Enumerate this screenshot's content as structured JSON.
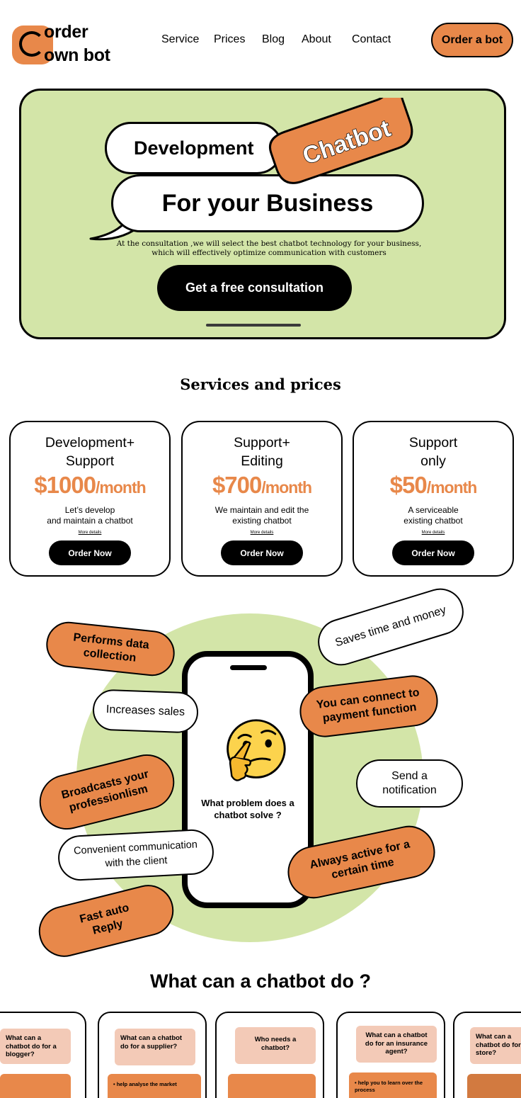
{
  "header": {
    "logo_line1": "order",
    "logo_line2": "own bot",
    "nav": [
      "Service",
      "Prices",
      "Blog",
      "About",
      "Contact"
    ],
    "cta": "Order a bot"
  },
  "hero": {
    "line1": "Development",
    "bubble": "Chatbot",
    "line2": "For your Business",
    "subtitle_1": "At the consultation ,we will select the best chatbot technology for your business,",
    "subtitle_2": "which will effectively optimize communication with customers",
    "cta": "Get a free consultation"
  },
  "services": {
    "title": "Services and prices",
    "cards": [
      {
        "title_1": "Development+",
        "title_2": "Support",
        "price": "$1000",
        "per": "/month",
        "desc_1": "Let’s develop",
        "desc_2": "and maintain a chatbot",
        "more": "More details",
        "button": "Order Now"
      },
      {
        "title_1": "Support+",
        "title_2": "Editing",
        "price": "$700",
        "per": "/month",
        "desc_1": "We maintain and edit the",
        "desc_2": "existing chatbot",
        "more": "More details",
        "button": "Order Now"
      },
      {
        "title_1": "Support",
        "title_2": "only",
        "price": "$50",
        "per": "/month",
        "desc_1": "A serviceable",
        "desc_2": "existing chatbot",
        "more": "More details",
        "button": "Order Now"
      }
    ]
  },
  "problem": {
    "question_1": "What problem does a",
    "question_2": "chatbot solve ?",
    "tags": [
      {
        "l1": "Performs data",
        "l2": "collection"
      },
      {
        "l1": "Saves time and money",
        "l2": ""
      },
      {
        "l1": "Increases sales",
        "l2": ""
      },
      {
        "l1": "You can connect to",
        "l2": "payment  function"
      },
      {
        "l1": "Broadcasts your",
        "l2": "professionlism"
      },
      {
        "l1": "Send a",
        "l2": "notification"
      },
      {
        "l1": "Convenient communication",
        "l2": "with the client"
      },
      {
        "l1": "Always active for a",
        "l2": "certain time"
      },
      {
        "l1": "Fast auto",
        "l2": "Reply"
      }
    ]
  },
  "what_can": {
    "title": "What can a chatbot do ?",
    "cards": [
      {
        "q": "What can a chatbot do for a blogger?",
        "item": ""
      },
      {
        "q": "What can a chatbot do for a supplier?",
        "item": "help analyse the market"
      },
      {
        "q": "Who needs a chatbot?",
        "item": ""
      },
      {
        "q": "What can a chatbot do for an insurance agent?",
        "item": "help you to learn over the process"
      },
      {
        "q": "What can a chatbot do for a store?",
        "item": ""
      }
    ]
  },
  "colors": {
    "accent": "#e8884a",
    "green": "#d3e5a8",
    "peach": "#f3cab7"
  }
}
